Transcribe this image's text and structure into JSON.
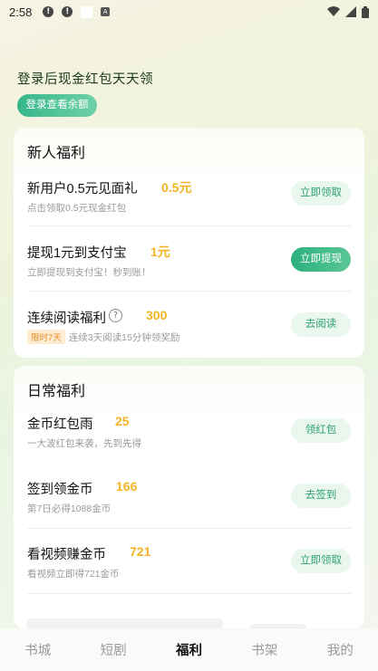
{
  "status_bar": {
    "time": "2:58",
    "icons": [
      "alert-circle-icon",
      "alert-circle-icon",
      "blank-square-icon",
      "a-box-icon",
      "wifi-icon",
      "signal-icon",
      "battery-icon"
    ]
  },
  "hero": {
    "title": "登录后现金红包天天领",
    "login_button": "登录查看余额"
  },
  "new_user": {
    "title": "新人福利",
    "items": [
      {
        "title": "新用户0.5元见面礼",
        "value": "0.5元",
        "subtitle": "点击领取0.5元现金红包",
        "button": "立即领取",
        "primary": false
      },
      {
        "title": "提现1元到支付宝",
        "value": "1元",
        "subtitle": "立即提现到支付宝！秒到账！",
        "button": "立即提现",
        "primary": true
      },
      {
        "title": "连续阅读福利",
        "value": "300",
        "tag": "限时7天",
        "subtitle": "连续3天阅读15分钟领奖励",
        "button": "去阅读",
        "primary": false
      }
    ]
  },
  "daily": {
    "title": "日常福利",
    "items": [
      {
        "title": "金币红包雨",
        "value": "25",
        "subtitle": "一大波红包来袭，先到先得",
        "button": "领红包"
      },
      {
        "title": "签到领金币",
        "value": "166",
        "subtitle": "第7日必得1088金币",
        "button": "去签到"
      },
      {
        "title": "看视频赚金币",
        "value": "721",
        "subtitle": "看视频立即得721金币",
        "button": "立即领取"
      }
    ]
  },
  "tabs": [
    {
      "label": "书城",
      "active": false
    },
    {
      "label": "短剧",
      "active": false
    },
    {
      "label": "福利",
      "active": true
    },
    {
      "label": "书架",
      "active": false
    },
    {
      "label": "我的",
      "active": false
    }
  ],
  "colors": {
    "accent_green": "#2ea174",
    "value_orange": "#f3b324",
    "tag_orange": "#e3902a"
  }
}
